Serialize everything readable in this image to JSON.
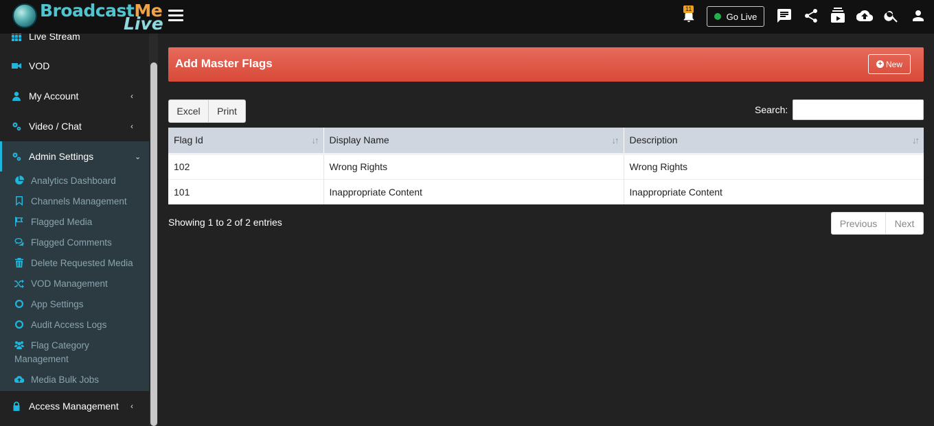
{
  "brand": {
    "word1": "Broadcast",
    "word2": "Me",
    "word3": "Live"
  },
  "topbar": {
    "notification_count": "11",
    "go_live_label": "Go Live"
  },
  "sidebar": {
    "items": [
      {
        "label": "Live Stream",
        "icon": "grid-icon"
      },
      {
        "label": "VOD",
        "icon": "video-camera-icon"
      },
      {
        "label": "My Account",
        "icon": "user-icon"
      },
      {
        "label": "Video / Chat",
        "icon": "cogs-icon"
      },
      {
        "label": "Admin Settings",
        "icon": "cogs-icon",
        "active": true
      },
      {
        "label": "Access Management",
        "icon": "lock-icon"
      }
    ],
    "submenu": [
      {
        "label": "Analytics Dashboard",
        "icon": "pie-chart-icon"
      },
      {
        "label": "Channels Management",
        "icon": "bookmark-icon"
      },
      {
        "label": "Flagged Media",
        "icon": "flag-icon"
      },
      {
        "label": "Flagged Comments",
        "icon": "comments-icon"
      },
      {
        "label": "Delete Requested Media",
        "icon": "trash-icon"
      },
      {
        "label": "VOD Management",
        "icon": "random-icon"
      },
      {
        "label": "App Settings",
        "icon": "circle-icon"
      },
      {
        "label": "Audit Access Logs",
        "icon": "circle-icon"
      },
      {
        "label": "Flag Category",
        "label2": "Management",
        "icon": "users-icon"
      },
      {
        "label": "Media Bulk Jobs",
        "icon": "cloud-upload-icon"
      }
    ]
  },
  "panel": {
    "title": "Add Master Flags",
    "new_label": "New"
  },
  "toolbar": {
    "excel_label": "Excel",
    "print_label": "Print",
    "search_label": "Search:",
    "search_value": ""
  },
  "table": {
    "columns": [
      "Flag Id",
      "Display Name",
      "Description"
    ],
    "rows": [
      [
        "102",
        "Wrong Rights",
        "Wrong Rights"
      ],
      [
        "101",
        "Inappropriate Content",
        "Inappropriate Content"
      ]
    ]
  },
  "footer": {
    "info": "Showing 1 to 2 of 2 entries",
    "previous_label": "Previous",
    "next_label": "Next"
  },
  "colors": {
    "accent": "#1fb6dd",
    "panel_header": "#d84a38",
    "live_dot": "#22b24c",
    "badge": "#f0a020"
  }
}
